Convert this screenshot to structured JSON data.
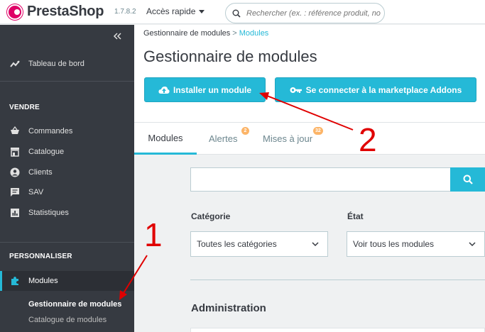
{
  "brand": {
    "name": "PrestaShop",
    "version": "1.7.8.2"
  },
  "topbar": {
    "quick_access": "Accès rapide",
    "search_placeholder": "Rechercher (ex. : référence produit, no"
  },
  "sidebar": {
    "dashboard": "Tableau de bord",
    "section_sell": "VENDRE",
    "sell_items": [
      {
        "label": "Commandes",
        "icon": "cart-icon"
      },
      {
        "label": "Catalogue",
        "icon": "store-icon"
      },
      {
        "label": "Clients",
        "icon": "user-icon"
      },
      {
        "label": "SAV",
        "icon": "chat-icon"
      },
      {
        "label": "Statistiques",
        "icon": "chart-icon"
      }
    ],
    "section_customize": "PERSONNALISER",
    "modules": "Modules",
    "sub_items": [
      "Gestionnaire de modules",
      "Catalogue de modules"
    ]
  },
  "breadcrumb": {
    "parent": "Gestionnaire de modules",
    "separator": ">",
    "current": "Modules"
  },
  "page_title": "Gestionnaire de modules",
  "buttons": {
    "install": "Installer un module",
    "addons": "Se connecter à la marketplace Addons"
  },
  "tabs": [
    {
      "label": "Modules",
      "badge": ""
    },
    {
      "label": "Alertes",
      "badge": "2"
    },
    {
      "label": "Mises à jour",
      "badge": "32"
    }
  ],
  "filters": {
    "category_label": "Catégorie",
    "category_value": "Toutes les catégories",
    "state_label": "État",
    "state_value": "Voir tous les modules"
  },
  "section_title": "Administration",
  "annotations": {
    "one": "1",
    "two": "2",
    "color": "#e00000"
  },
  "colors": {
    "accent": "#25b9d7",
    "sidebar": "#363a41",
    "badge": "#fcb467",
    "brand": "#df0067"
  }
}
